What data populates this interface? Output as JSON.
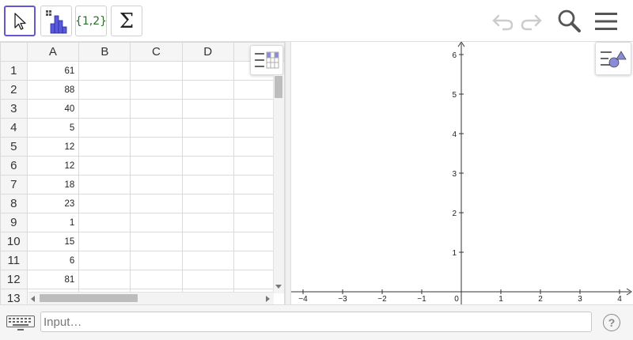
{
  "toolbar": {
    "tools": [
      {
        "name": "move-tool",
        "icon": "cursor-arrow-icon"
      },
      {
        "name": "histogram-tool",
        "icon": "histogram-icon"
      },
      {
        "name": "list-tool",
        "label": "{1,2}"
      },
      {
        "name": "sum-tool",
        "label": "Σ"
      }
    ],
    "right": [
      "undo-icon",
      "redo-icon",
      "search-icon",
      "hamburger-menu-icon"
    ]
  },
  "spreadsheet": {
    "columns": [
      "A",
      "B",
      "C",
      "D"
    ],
    "rows": [
      {
        "n": "1",
        "a": "61"
      },
      {
        "n": "2",
        "a": "88"
      },
      {
        "n": "3",
        "a": "40"
      },
      {
        "n": "4",
        "a": "5"
      },
      {
        "n": "5",
        "a": "12"
      },
      {
        "n": "6",
        "a": "12"
      },
      {
        "n": "7",
        "a": "18"
      },
      {
        "n": "8",
        "a": "23"
      },
      {
        "n": "9",
        "a": "1"
      },
      {
        "n": "10",
        "a": "15"
      },
      {
        "n": "11",
        "a": "6"
      },
      {
        "n": "12",
        "a": "81"
      },
      {
        "n": "13",
        "a": ""
      }
    ]
  },
  "graphics": {
    "x_ticks": [
      "−4",
      "−3",
      "−2",
      "−1",
      "0",
      "1",
      "2",
      "3",
      "4"
    ],
    "y_ticks": [
      "1",
      "2",
      "3",
      "4",
      "5",
      "6"
    ]
  },
  "inputbar": {
    "placeholder": "Input…",
    "help": "?"
  },
  "colors": {
    "accent": "#6557d2",
    "tool_icon": "#4a4ac8",
    "set_text": "#2d6b2d"
  }
}
